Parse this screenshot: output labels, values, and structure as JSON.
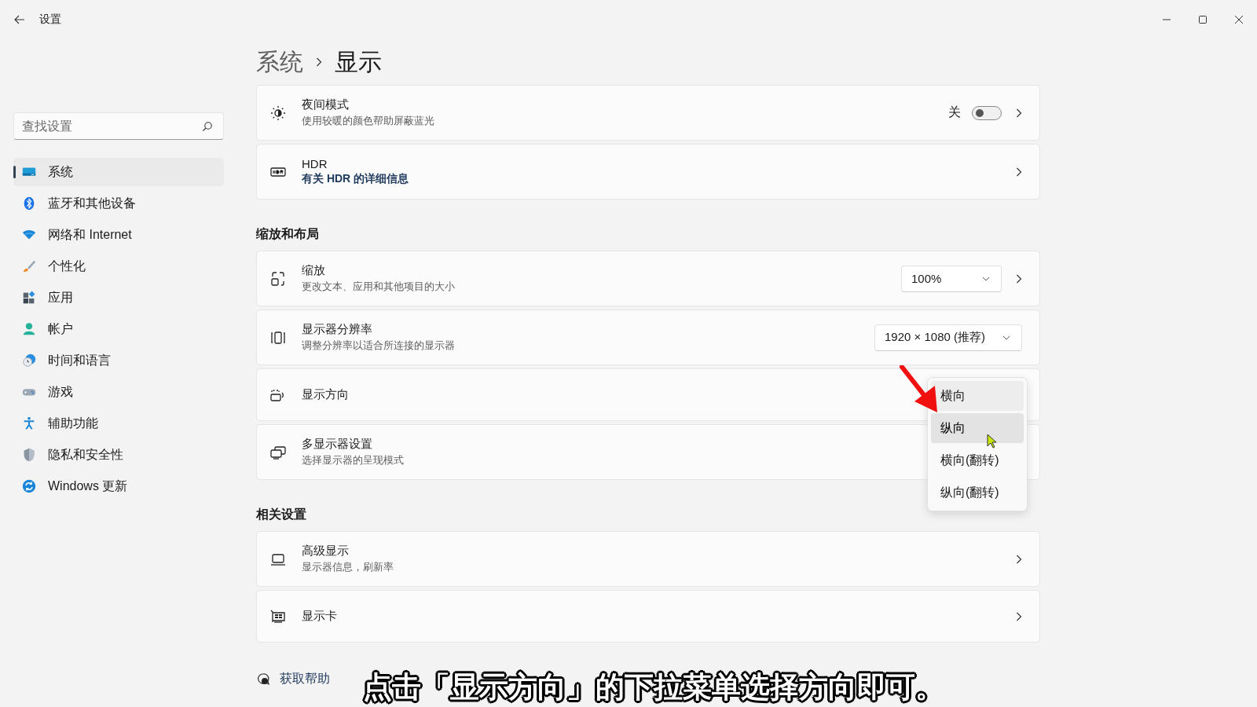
{
  "window": {
    "title": "设置"
  },
  "search": {
    "placeholder": "查找设置"
  },
  "sidebar": {
    "items": [
      {
        "label": "系统",
        "selected": true
      },
      {
        "label": "蓝牙和其他设备",
        "selected": false
      },
      {
        "label": "网络和 Internet",
        "selected": false
      },
      {
        "label": "个性化",
        "selected": false
      },
      {
        "label": "应用",
        "selected": false
      },
      {
        "label": "帐户",
        "selected": false
      },
      {
        "label": "时间和语言",
        "selected": false
      },
      {
        "label": "游戏",
        "selected": false
      },
      {
        "label": "辅助功能",
        "selected": false
      },
      {
        "label": "隐私和安全性",
        "selected": false
      },
      {
        "label": "Windows 更新",
        "selected": false
      }
    ]
  },
  "breadcrumb": {
    "parent": "系统",
    "current": "显示"
  },
  "sections": [
    {
      "cards": [
        {
          "title": "夜间模式",
          "subtitle": "使用较暖的颜色帮助屏蔽蓝光",
          "control": {
            "kind": "toggle",
            "label": "关",
            "on": false
          },
          "chevron": true
        },
        {
          "title": "HDR",
          "link_subtitle": "有关 HDR 的详细信息",
          "chevron": true
        }
      ]
    },
    {
      "heading": "缩放和布局",
      "cards": [
        {
          "title": "缩放",
          "subtitle": "更改文本、应用和其他项目的大小",
          "control": {
            "kind": "dropdown",
            "value": "100%"
          },
          "chevron": true
        },
        {
          "title": "显示器分辨率",
          "subtitle": "调整分辨率以适合所连接的显示器",
          "control": {
            "kind": "dropdown",
            "value": "1920 × 1080 (推荐)"
          },
          "chevron": false
        },
        {
          "title": "显示方向",
          "control": {
            "kind": "menu",
            "options": [
              {
                "label": "横向",
                "selected": true,
                "hovered": false
              },
              {
                "label": "纵向",
                "selected": false,
                "hovered": true
              },
              {
                "label": "横向(翻转)",
                "selected": false,
                "hovered": false
              },
              {
                "label": "纵向(翻转)",
                "selected": false,
                "hovered": false
              }
            ]
          },
          "chevron": false
        },
        {
          "title": "多显示器设置",
          "subtitle": "选择显示器的呈现模式",
          "chevron": false
        }
      ]
    },
    {
      "heading": "相关设置",
      "cards": [
        {
          "title": "高级显示",
          "subtitle": "显示器信息，刷新率",
          "chevron": true
        },
        {
          "title": "显示卡",
          "chevron": true
        }
      ]
    }
  ],
  "help_links": [
    {
      "label": "获取帮助"
    }
  ],
  "caption": "点击「显示方向」的下拉菜单选择方向即可。"
}
